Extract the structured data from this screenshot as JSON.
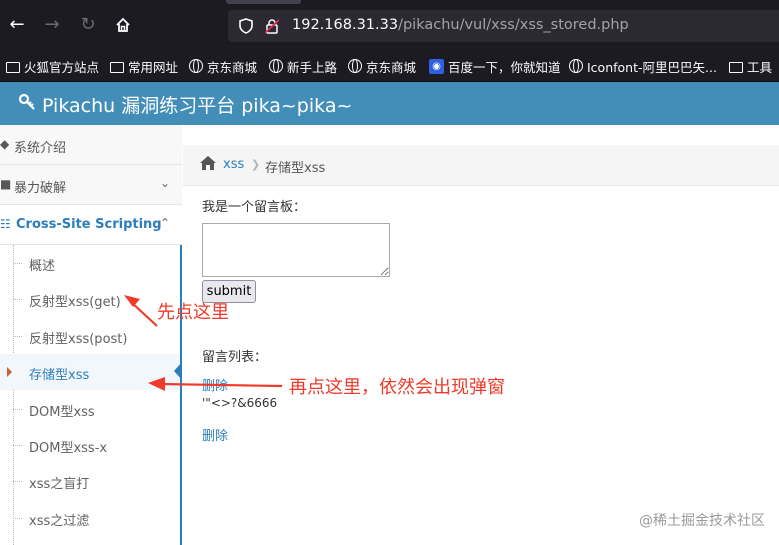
{
  "browser": {
    "url_host": "192.168.31.33",
    "url_path": "/pikachu/vul/xss/xss_stored.php",
    "bookmarks": [
      "火狐官方站点",
      "常用网址",
      "京东商城",
      "新手上路",
      "京东商城",
      "百度一下，你就知道",
      "Iconfont-阿里巴巴矢...",
      "工具"
    ]
  },
  "header": {
    "title": "Pikachu 漏洞练习平台 pika~pika~"
  },
  "sidebar": {
    "items": [
      {
        "label": "系统介绍"
      },
      {
        "label": "暴力破解"
      },
      {
        "label": "Cross-Site Scripting"
      }
    ],
    "subitems": [
      "概述",
      "反射型xss(get)",
      "反射型xss(post)",
      "存储型xss",
      "DOM型xss",
      "DOM型xss-x",
      "xss之盲打",
      "xss之过滤"
    ]
  },
  "breadcrumb": {
    "section": "xss",
    "current": "存储型xss"
  },
  "form": {
    "board_label": "我是一个留言板：",
    "textarea_value": "",
    "submit_label": "submit"
  },
  "messages": {
    "list_label": "留言列表：",
    "items": [
      {
        "delete_label": "删除",
        "text": "'\"<>?&6666"
      },
      {
        "delete_label": "删除",
        "text": ""
      }
    ]
  },
  "annotations": {
    "first": "先点这里",
    "second": "再点这里，依然会出现弹窗"
  },
  "watermark": "@稀土掘金技术社区",
  "colors": {
    "header_bg": "#438eb9",
    "link": "#2b7dbc",
    "annotation": "#ef3a2b",
    "browser_bg": "#1c1b22"
  }
}
